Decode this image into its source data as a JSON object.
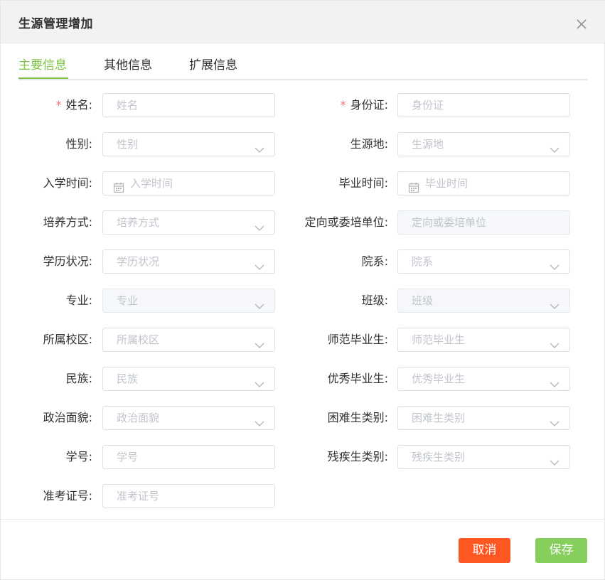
{
  "dialog": {
    "title": "生源管理增加"
  },
  "tabs": [
    {
      "label": "主要信息",
      "active": true
    },
    {
      "label": "其他信息",
      "active": false
    },
    {
      "label": "扩展信息",
      "active": false
    }
  ],
  "form": {
    "left": [
      {
        "label": "姓名:",
        "required": true,
        "placeholder": "姓名",
        "type": "text"
      },
      {
        "label": "性别:",
        "placeholder": "性别",
        "type": "select"
      },
      {
        "label": "入学时间:",
        "placeholder": "入学时间",
        "type": "date"
      },
      {
        "label": "培养方式:",
        "placeholder": "培养方式",
        "type": "select"
      },
      {
        "label": "学历状况:",
        "placeholder": "学历状况",
        "type": "select"
      },
      {
        "label": "专业:",
        "placeholder": "专业",
        "type": "select",
        "disabled": true
      },
      {
        "label": "所属校区:",
        "placeholder": "所属校区",
        "type": "select"
      },
      {
        "label": "民族:",
        "placeholder": "民族",
        "type": "select"
      },
      {
        "label": "政治面貌:",
        "placeholder": "政治面貌",
        "type": "select"
      },
      {
        "label": "学号:",
        "placeholder": "学号",
        "type": "text"
      },
      {
        "label": "准考证号:",
        "placeholder": "准考证号",
        "type": "text"
      }
    ],
    "right": [
      {
        "label": "身份证:",
        "required": true,
        "placeholder": "身份证",
        "type": "text"
      },
      {
        "label": "生源地:",
        "placeholder": "生源地",
        "type": "select"
      },
      {
        "label": "毕业时间:",
        "placeholder": "毕业时间",
        "type": "date"
      },
      {
        "label": "定向或委培单位:",
        "placeholder": "定向或委培单位",
        "type": "text",
        "disabled": true
      },
      {
        "label": "院系:",
        "placeholder": "院系",
        "type": "select"
      },
      {
        "label": "班级:",
        "placeholder": "班级",
        "type": "select",
        "disabled": true
      },
      {
        "label": "师范毕业生:",
        "placeholder": "师范毕业生",
        "type": "select"
      },
      {
        "label": "优秀毕业生:",
        "placeholder": "优秀毕业生",
        "type": "select"
      },
      {
        "label": "困难生类别:",
        "placeholder": "困难生类别",
        "type": "select"
      },
      {
        "label": "残疾生类别:",
        "placeholder": "残疾生类别",
        "type": "select"
      }
    ]
  },
  "buttons": {
    "cancel": "取消",
    "save": "保存"
  },
  "colors": {
    "accent": "#7dc242",
    "required": "#f56c6c",
    "cancel": "#ff5722",
    "save": "#86cf5c"
  },
  "icons": {
    "close": "close-icon",
    "select": "chevron-down-icon",
    "date": "calendar-icon"
  }
}
